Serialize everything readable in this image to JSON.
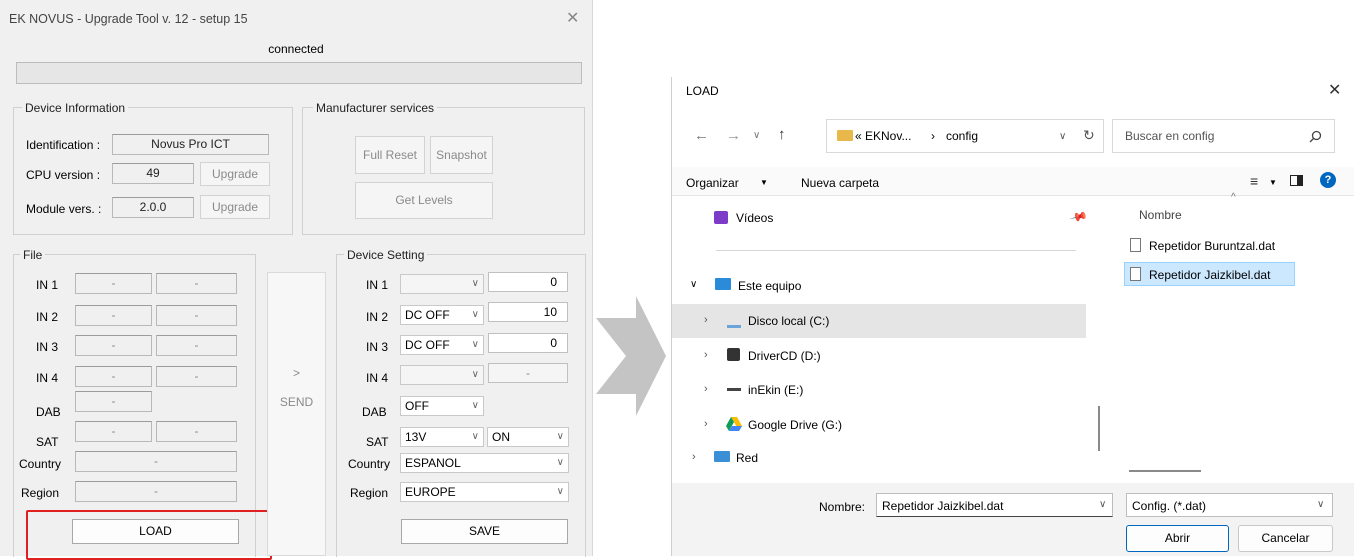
{
  "upgrade_tool": {
    "title": "EK NOVUS - Upgrade Tool v. 12 - setup 15",
    "status": "connected",
    "device_info": {
      "title": "Device Information",
      "identification_label": "Identification :",
      "identification_value": "Novus Pro ICT",
      "cpu_label": "CPU version :",
      "cpu_value": "49",
      "module_label": "Module vers. :",
      "module_value": "2.0.0",
      "upgrade_label": "Upgrade"
    },
    "manufacturer": {
      "title": "Manufacturer services",
      "full_reset": "Full Reset",
      "snapshot": "Snapshot",
      "get_levels": "Get Levels"
    },
    "file": {
      "title": "File",
      "rows": [
        {
          "label": "IN 1",
          "a": "-",
          "b": "-"
        },
        {
          "label": "IN 2",
          "a": "-",
          "b": "-"
        },
        {
          "label": "IN 3",
          "a": "-",
          "b": "-"
        },
        {
          "label": "IN 4",
          "a": "-",
          "b": "-"
        },
        {
          "label": "DAB",
          "a": "-"
        },
        {
          "label": "SAT",
          "a": "-",
          "b": "-"
        },
        {
          "label": "Country",
          "a": "-"
        },
        {
          "label": "Region",
          "a": "-"
        }
      ],
      "load": "LOAD"
    },
    "send": {
      "arrow": ">",
      "label": "SEND"
    },
    "device_setting": {
      "title": "Device Setting",
      "in1": {
        "label": "IN 1",
        "combo": "",
        "value": "0"
      },
      "in2": {
        "label": "IN 2",
        "combo": "DC OFF",
        "value": "10"
      },
      "in3": {
        "label": "IN 3",
        "combo": "DC OFF",
        "value": "0"
      },
      "in4": {
        "label": "IN 4",
        "combo": "",
        "value": "-"
      },
      "dab": {
        "label": "DAB",
        "combo": "OFF"
      },
      "sat": {
        "label": "SAT",
        "combo": "13V",
        "combo2": "ON"
      },
      "country": {
        "label": "Country",
        "combo": "ESPANOL"
      },
      "region": {
        "label": "Region",
        "combo": "EUROPE"
      },
      "save": "SAVE"
    },
    "highlight_color": "#e02020"
  },
  "load_dialog": {
    "title": "LOAD",
    "address": {
      "path1": "« EKNov...",
      "sep": "›",
      "path2": "config"
    },
    "search_placeholder": "Buscar en config",
    "toolbar": {
      "organize": "Organizar",
      "new_folder": "Nueva carpeta"
    },
    "nav": {
      "videos": "Vídeos",
      "this_pc": "Este equipo",
      "drive_c": "Disco local (C:)",
      "drive_d": "DriverCD (D:)",
      "drive_e": "inEkin (E:)",
      "drive_g": "Google Drive (G:)",
      "network": "Red"
    },
    "column_name": "Nombre",
    "files": [
      "Repetidor Buruntzal.dat",
      "Repetidor Jaizkibel.dat"
    ],
    "filename_label": "Nombre:",
    "filename_value": "Repetidor Jaizkibel.dat",
    "filter": "Config. (*.dat)",
    "open": "Abrir",
    "cancel": "Cancelar",
    "accent_color": "#0067c0",
    "selected_color": "#cce8ff"
  }
}
